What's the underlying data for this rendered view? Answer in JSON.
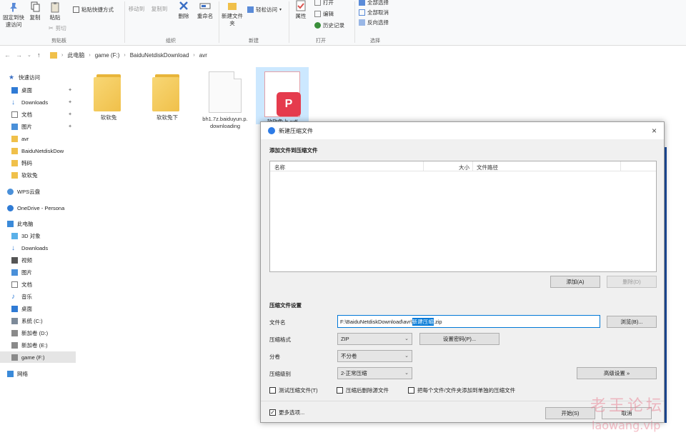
{
  "ribbon": {
    "pin_label": "固定到快速访问",
    "copy_label": "复制",
    "paste_label": "粘贴",
    "paste_shortcut_label": "粘贴快捷方式",
    "cut_label": "剪切",
    "clipboard_group": "剪贴板",
    "move_to_label": "移动到",
    "copy_to_label": "复制到",
    "delete_label": "删除",
    "rename_label": "重命名",
    "organize_group": "组织",
    "new_folder_label": "新建文件夹",
    "easy_access_label": "轻松访问",
    "new_group": "新建",
    "properties_label": "属性",
    "open_label": "打开",
    "edit_label": "编辑",
    "history_label": "历史记录",
    "open_group": "打开",
    "select_all_label": "全部选择",
    "select_none_label": "全部取消",
    "invert_selection_label": "反向选择",
    "select_group": "选择"
  },
  "address": {
    "crumbs": [
      "此电脑",
      "game (F:)",
      "BaiduNetdiskDownload",
      "avr"
    ]
  },
  "sidebar": {
    "items": [
      {
        "label": "快速访问"
      },
      {
        "label": "桌面"
      },
      {
        "label": "Downloads"
      },
      {
        "label": "文档"
      },
      {
        "label": "图片"
      },
      {
        "label": "avr"
      },
      {
        "label": "BaiduNetdiskDow"
      },
      {
        "label": "韩码"
      },
      {
        "label": "软软兔"
      },
      {
        "label": "WPS云盘"
      },
      {
        "label": "OneDrive - Persona"
      },
      {
        "label": "此电脑"
      },
      {
        "label": "3D 对象"
      },
      {
        "label": "Downloads"
      },
      {
        "label": "视频"
      },
      {
        "label": "图片"
      },
      {
        "label": "文档"
      },
      {
        "label": "音乐"
      },
      {
        "label": "桌面"
      },
      {
        "label": "系统 (C:)"
      },
      {
        "label": "新加卷 (D:)"
      },
      {
        "label": "新加卷 (E:)"
      },
      {
        "label": "game (F:)"
      },
      {
        "label": "网络"
      }
    ]
  },
  "files": [
    {
      "name": "软软兔"
    },
    {
      "name": "软软兔下"
    },
    {
      "name": "bh1.7z.baiduyun.p.downloading"
    },
    {
      "name": "软软兔上.pdf"
    }
  ],
  "dialog": {
    "title": "新建压缩文件",
    "add_section": "添加文件到压缩文件",
    "col_name": "名称",
    "col_size": "大小",
    "col_path": "文件路径",
    "add_button": "添加(A)",
    "remove_button": "删除(D)",
    "settings_section": "压缩文件设置",
    "filename_label": "文件名",
    "filename_prefix": "F:\\BaiduNetdiskDownload\\avr\\",
    "filename_selected": "新建压缩",
    "filename_suffix": ".zip",
    "browse_button": "浏览(B)...",
    "format_label": "压缩格式",
    "format_value": "ZIP",
    "password_button": "设置密码(P)...",
    "split_label": "分卷",
    "split_value": "不分卷",
    "level_label": "压缩级别",
    "level_value": "2-正常压缩",
    "advanced_button": "高级设置 »",
    "test_label": "测试压缩文件(T)",
    "delete_after_label": "压缩后删除源文件",
    "each_file_label": "把每个文件/文件夹添加到单独的压缩文件",
    "more_options_label": "更多选项...",
    "start_button": "开始(S)",
    "cancel_button": "取消"
  },
  "watermark": {
    "cn": "老王论坛",
    "url": "laowang.vip"
  },
  "colors": {
    "accent": "#0078d7",
    "folder": "#f0c04a",
    "wps_red": "#e53b4d"
  }
}
